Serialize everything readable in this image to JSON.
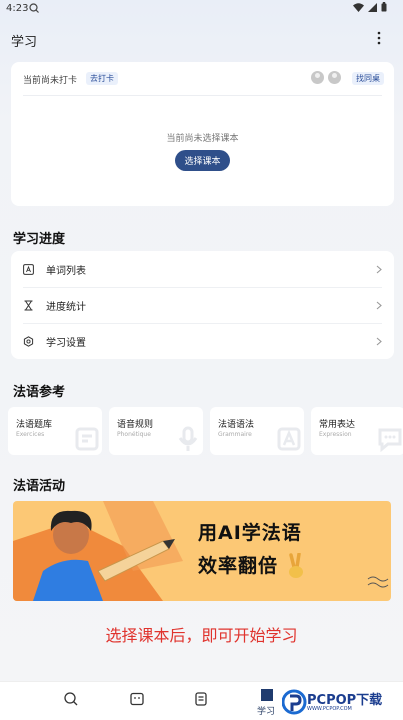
{
  "status_bar": {
    "time": "4:23"
  },
  "header": {
    "title": "学习"
  },
  "checkin_card": {
    "status_text": "当前尚未打卡",
    "checkin_link": "去打卡",
    "find_link": "找同桌",
    "empty_text": "当前尚未选择课本",
    "select_button": "选择课本"
  },
  "progress_section": {
    "title": "学习进度",
    "items": [
      {
        "label": "单词列表",
        "icon": "a-letter-icon"
      },
      {
        "label": "进度统计",
        "icon": "hourglass-icon"
      },
      {
        "label": "学习设置",
        "icon": "settings-icon"
      }
    ]
  },
  "reference_section": {
    "title": "法语参考",
    "cards": [
      {
        "title": "法语题库",
        "subtitle": "Exercices",
        "icon": "exercise-icon"
      },
      {
        "title": "语音规则",
        "subtitle": "Phonétique",
        "icon": "microphone-icon"
      },
      {
        "title": "法语语法",
        "subtitle": "Grammaire",
        "icon": "grammar-icon"
      },
      {
        "title": "常用表达",
        "subtitle": "Expression",
        "icon": "chat-icon"
      }
    ]
  },
  "activity_section": {
    "title": "法语活动",
    "banner_line1": "用AI学法语",
    "banner_line2": "效率翻倍"
  },
  "promo_text": "选择课本后，即可开始学习",
  "bottom_nav": {
    "active_label": "学习",
    "items": [
      "search-icon",
      "message-icon",
      "note-icon",
      "study-icon"
    ]
  },
  "watermark": {
    "text": "PCPOP下载",
    "sub": "WWW.PCPOP.COM"
  },
  "colors": {
    "accent": "#2f4f8a",
    "banner": "#fcc875",
    "promo": "#e0332d"
  }
}
